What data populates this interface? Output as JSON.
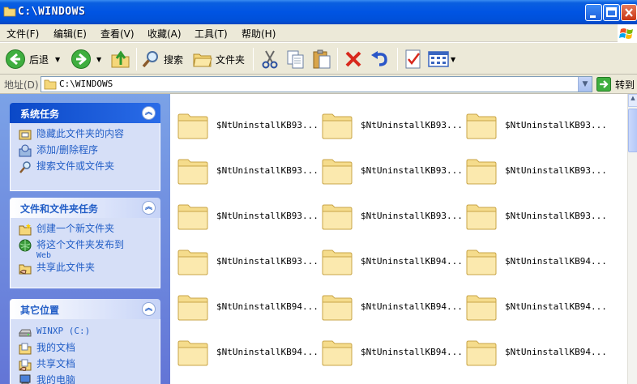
{
  "window": {
    "title": "C:\\WINDOWS"
  },
  "menubar": {
    "items": [
      "文件(F)",
      "编辑(E)",
      "查看(V)",
      "收藏(A)",
      "工具(T)",
      "帮助(H)"
    ]
  },
  "toolbar": {
    "back_label": "后退",
    "search_label": "搜索",
    "folders_label": "文件夹"
  },
  "address": {
    "label": "地址(D)",
    "value": "C:\\WINDOWS",
    "go_label": "转到"
  },
  "taskpane": {
    "system_tasks": {
      "title": "系统任务",
      "links": [
        "隐藏此文件夹的内容",
        "添加/删除程序",
        "搜索文件或文件夹"
      ]
    },
    "file_tasks": {
      "title": "文件和文件夹任务",
      "links": [
        "创建一个新文件夹",
        "将这个文件夹发布到",
        "共享此文件夹"
      ],
      "publish_sub": "Web"
    },
    "other_places": {
      "title": "其它位置",
      "links": [
        "WINXP (C:)",
        "我的文档",
        "共享文档",
        "我的电脑"
      ]
    }
  },
  "files": [
    "$NtUninstallKB93...",
    "$NtUninstallKB93...",
    "$NtUninstallKB93...",
    "$NtUninstallKB93...",
    "$NtUninstallKB93...",
    "$NtUninstallKB93...",
    "$NtUninstallKB93...",
    "$NtUninstallKB93...",
    "$NtUninstallKB93...",
    "$NtUninstallKB93...",
    "$NtUninstallKB94...",
    "$NtUninstallKB94...",
    "$NtUninstallKB94...",
    "$NtUninstallKB94...",
    "$NtUninstallKB94...",
    "$NtUninstallKB94...",
    "$NtUninstallKB94...",
    "$NtUninstallKB94..."
  ],
  "colors": {
    "titlebar": "#0054e3",
    "taskpane_bg": "#7ba2e7",
    "link": "#215dc6",
    "folder": "#f5dc8c"
  }
}
